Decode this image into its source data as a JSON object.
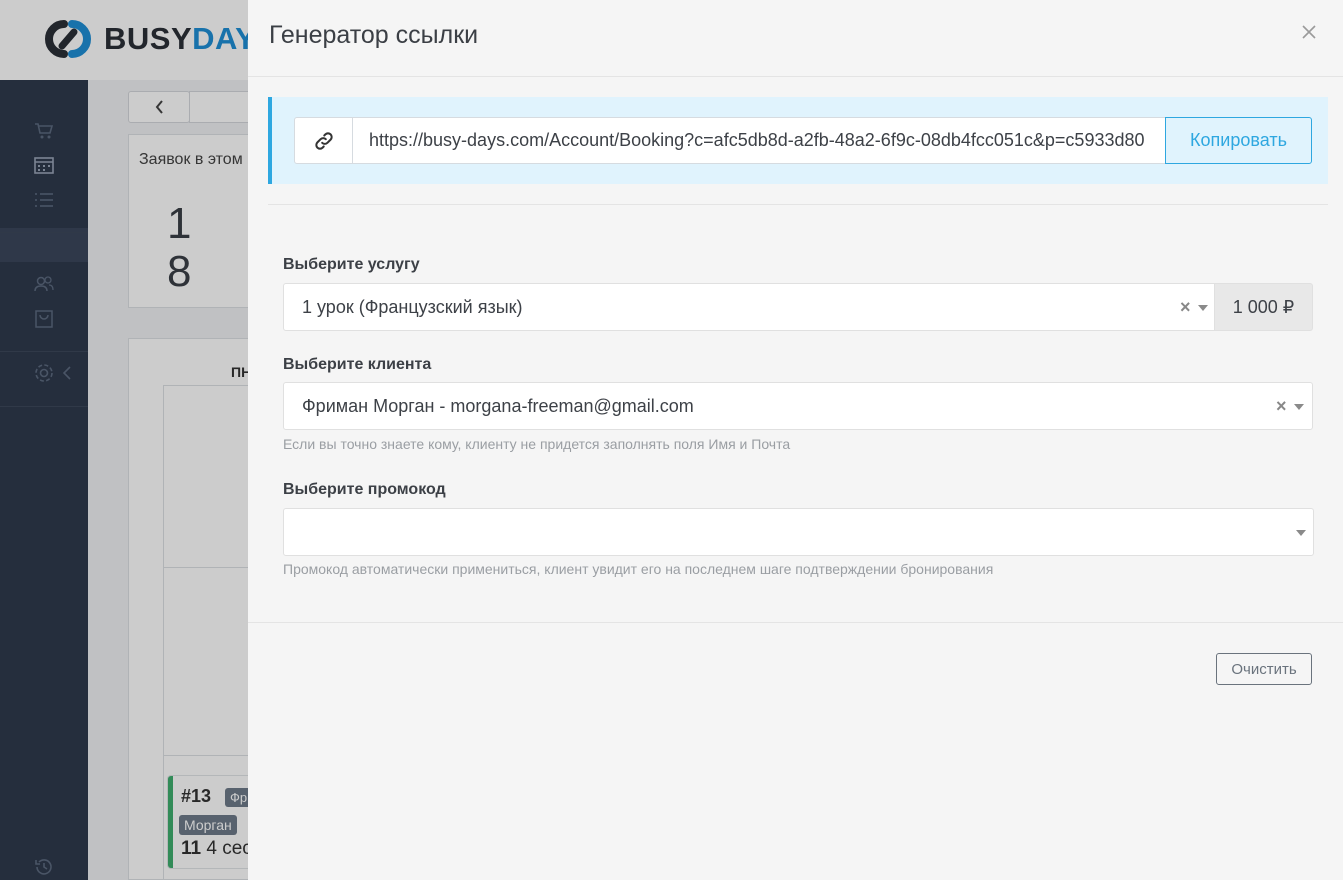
{
  "background": {
    "logo": {
      "text_dark": "BUSY",
      "text_accent": "DAY"
    },
    "stat_card": {
      "title": "Заявок в этом",
      "digits": [
        "1",
        "8"
      ]
    },
    "calendar": {
      "day_label": "ПН"
    },
    "event": {
      "number": "#13",
      "tag": "Фр",
      "client": "Морган",
      "count": "11",
      "rest": "4 сес"
    }
  },
  "modal": {
    "title": "Генератор ссылки",
    "link": {
      "url": "https://busy-days.com/Account/Booking?c=afc5db8d-a2fb-48a2-6f9c-08db4fcc051c&p=c5933d80",
      "copy_label": "Копировать"
    },
    "service": {
      "label": "Выберите услугу",
      "value": "1 урок (Французский язык)",
      "price": "1 000 ₽",
      "clear_glyph": "×"
    },
    "client": {
      "label": "Выберите клиента",
      "value": "Фриман Морган - morgana-freeman@gmail.com",
      "hint": "Если вы точно знаете кому, клиенту не придется заполнять поля Имя и Почта",
      "clear_glyph": "×"
    },
    "promo": {
      "label": "Выберите промокод",
      "value": "",
      "hint": "Промокод автоматически примениться, клиент увидит его на последнем шаге подтверждении бронирования"
    },
    "clear_button": "Очистить"
  },
  "colors": {
    "accent": "#2ea7e0",
    "sidebar": "#2f3a4d",
    "logo_accent": "#1f8fd6",
    "event_border": "#3fae6e"
  },
  "icons": [
    "link-icon",
    "close-icon",
    "cart-icon",
    "calendar-icon",
    "list-icon",
    "users-icon",
    "bag-icon",
    "gear-icon",
    "chevron-left-icon",
    "history-icon"
  ]
}
